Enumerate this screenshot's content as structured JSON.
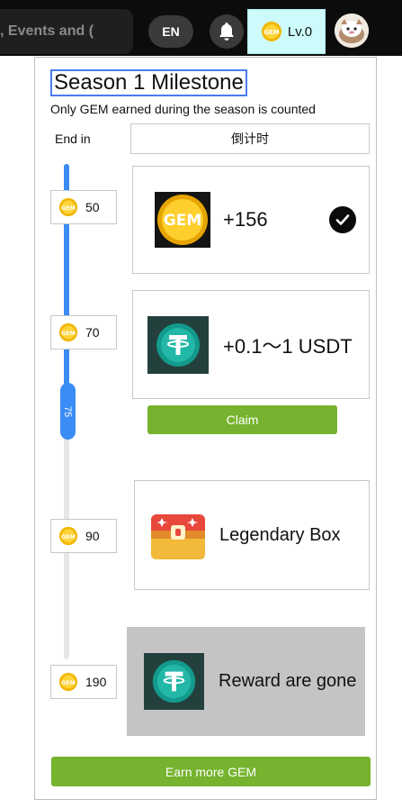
{
  "topbar": {
    "search_text": ", Events and (",
    "language": "EN",
    "level": "Lv.0",
    "icons": [
      "bell-icon",
      "gem-coin-icon",
      "avatar-image"
    ]
  },
  "milestone": {
    "title": "Season 1 Milestone",
    "subtitle": "Only GEM earned during the season is counted",
    "end_label": "End in",
    "countdown": "倒计时",
    "progress_value": "75",
    "thresholds": [
      "50",
      "70",
      "90",
      "190"
    ],
    "rewards": [
      {
        "text": "+156",
        "icon": "gem-coin-icon",
        "status": "claimed",
        "status_icon": "check-icon"
      },
      {
        "text": "+0.1～1 USDT",
        "icon": "usdt-icon",
        "status": "claimable"
      },
      {
        "text": "Legendary Box",
        "icon": "treasure-chest-icon",
        "status": "locked"
      },
      {
        "text": "Reward are gone",
        "icon": "usdt-icon",
        "status": "gone"
      }
    ],
    "claim_label": "Claim",
    "earn_label": "Earn more GEM"
  },
  "colors": {
    "accent_blue": "#3b8cf5",
    "action_green": "#76b32e",
    "level_bg": "#cdfafa",
    "gone_bg": "#c4c4c4"
  }
}
